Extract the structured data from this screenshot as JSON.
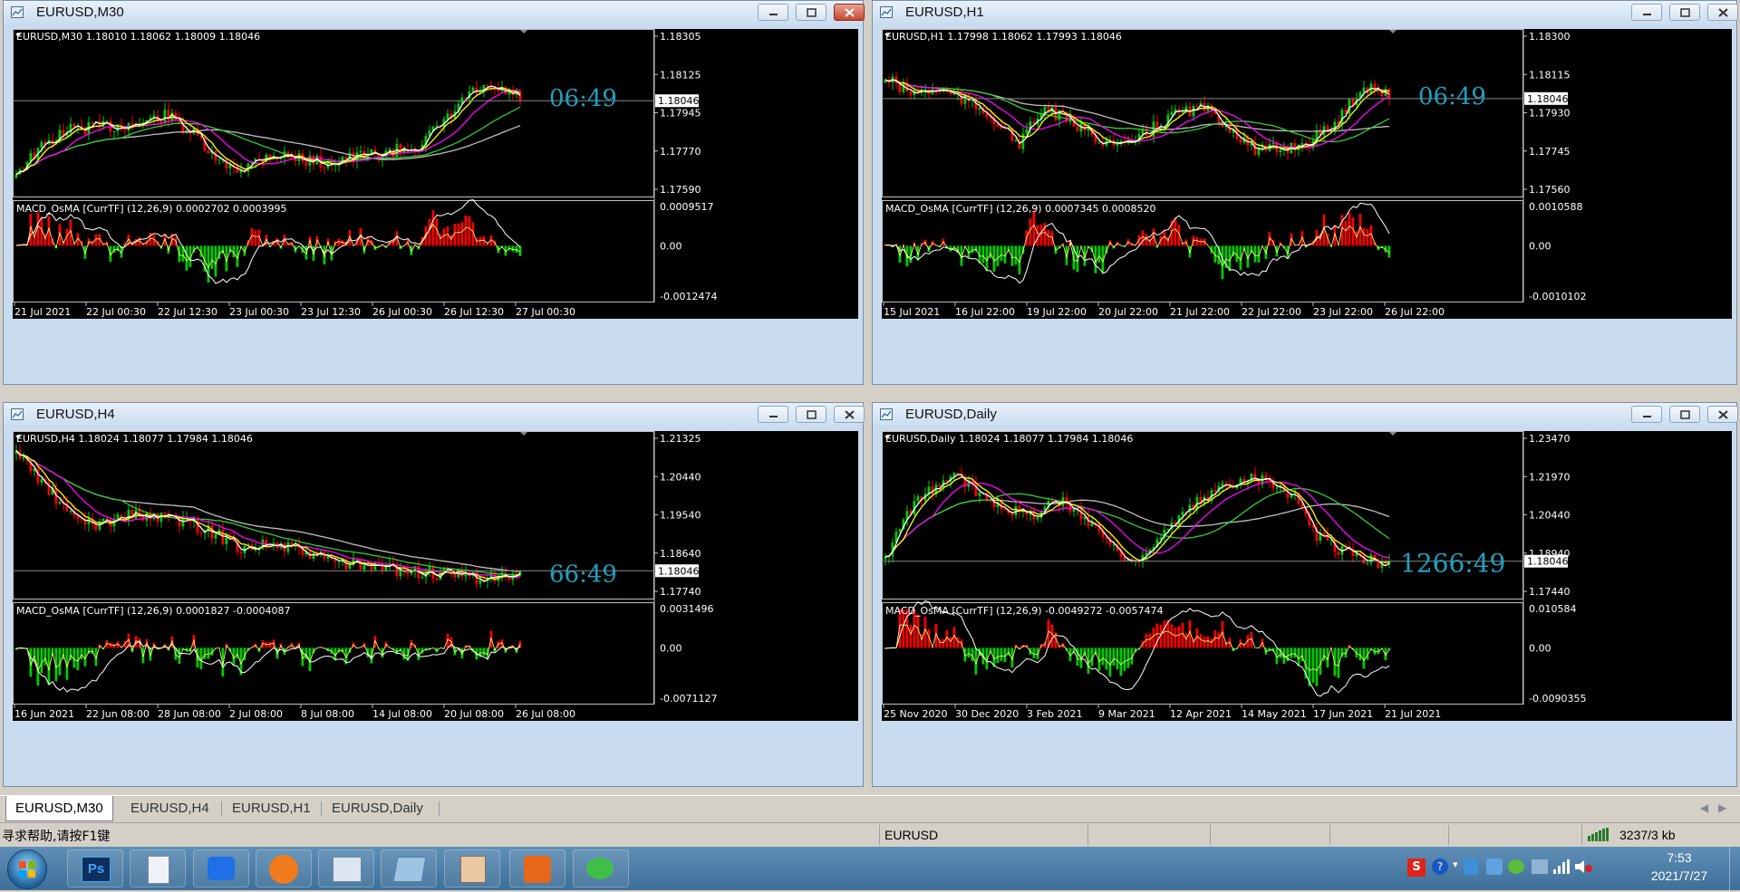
{
  "windows": [
    {
      "title": "EURUSD,M30",
      "info": "EURUSD,M30  1.18010 1.18062 1.18009 1.18046",
      "price_labels": [
        "1.18305",
        "1.18125",
        "1.17945",
        "1.17770",
        "1.17590"
      ],
      "current_price": "1.18046",
      "timer": "06:49",
      "macd_label": "MACD_OsMA [CurrTF] (12,26,9) 0.0002702 0.0003995",
      "macd_levels": [
        "0.0009517",
        "0.00",
        "-0.0012474"
      ],
      "time_labels": [
        "21 Jul 2021",
        "22 Jul 00:30",
        "22 Jul 12:30",
        "23 Jul 00:30",
        "23 Jul 12:30",
        "26 Jul 00:30",
        "26 Jul 12:30",
        "27 Jul 00:30"
      ]
    },
    {
      "title": "EURUSD,H1",
      "info": "EURUSD,H1  1.17998 1.18062 1.17993 1.18046",
      "price_labels": [
        "1.18300",
        "1.18115",
        "1.17930",
        "1.17745",
        "1.17560"
      ],
      "current_price": "1.18046",
      "timer": "06:49",
      "macd_label": "MACD_OsMA [CurrTF] (12,26,9) 0.0007345 0.0008520",
      "macd_levels": [
        "0.0010588",
        "0.00",
        "-0.0010102"
      ],
      "time_labels": [
        "15 Jul 2021",
        "16 Jul 22:00",
        "19 Jul 22:00",
        "20 Jul 22:00",
        "21 Jul 22:00",
        "22 Jul 22:00",
        "23 Jul 22:00",
        "26 Jul 22:00"
      ]
    },
    {
      "title": "EURUSD,H4",
      "info": "EURUSD,H4  1.18024 1.18077 1.17984 1.18046",
      "price_labels": [
        "1.21325",
        "1.20440",
        "1.19540",
        "1.18640",
        "1.17740"
      ],
      "current_price": "1.18046",
      "timer": "66:49",
      "macd_label": "MACD_OsMA [CurrTF] (12,26,9) 0.0001827 -0.0004087",
      "macd_levels": [
        "0.0031496",
        "0.00",
        "-0.0071127"
      ],
      "time_labels": [
        "16 Jun 2021",
        "22 Jun 08:00",
        "28 Jun 08:00",
        "2 Jul 08:00",
        "8 Jul 08:00",
        "14 Jul 08:00",
        "20 Jul 08:00",
        "26 Jul 08:00"
      ]
    },
    {
      "title": "EURUSD,Daily",
      "info": "EURUSD,Daily  1.18024 1.18077 1.17984 1.18046",
      "price_labels": [
        "1.23470",
        "1.21970",
        "1.20440",
        "1.18940",
        "1.17440"
      ],
      "current_price": "1.18046",
      "timer": "1266:49",
      "macd_label": "MACD_OsMA [CurrTF] (12,26,9) -0.0049272 -0.0057474",
      "macd_levels": [
        "0.010584",
        "0.00",
        "-0.0090355"
      ],
      "time_labels": [
        "25 Nov 2020",
        "30 Dec 2020",
        "3 Feb 2021",
        "9 Mar 2021",
        "12 Apr 2021",
        "14 May 2021",
        "17 Jun 2021",
        "21 Jul 2021"
      ]
    }
  ],
  "tabs": [
    "EURUSD,M30",
    "EURUSD,H4",
    "EURUSD,H1",
    "EURUSD,Daily"
  ],
  "status": {
    "help": "寻求帮助,请按F1键",
    "symbol": "EURUSD",
    "traffic": "3237/3 kb"
  },
  "clock": {
    "time": "7:53",
    "date": "2021/7/27"
  },
  "taskbar_apps": [
    "start-orb",
    "photoshop-app",
    "document-app",
    "maps-app",
    "refresh-app",
    "contacts-app",
    "notepad-app",
    "paint-app",
    "trading-app",
    "wechat-app"
  ],
  "colors": {
    "bull": "#00cc00",
    "bear": "#ff0000",
    "ma_white": "#ffffff",
    "ma_yellow": "#ffff00",
    "ma_magenta": "#ff00ff",
    "ma_green": "#32cd32",
    "ma_gray": "#c0c0c0",
    "timer": "#20a0c0"
  }
}
